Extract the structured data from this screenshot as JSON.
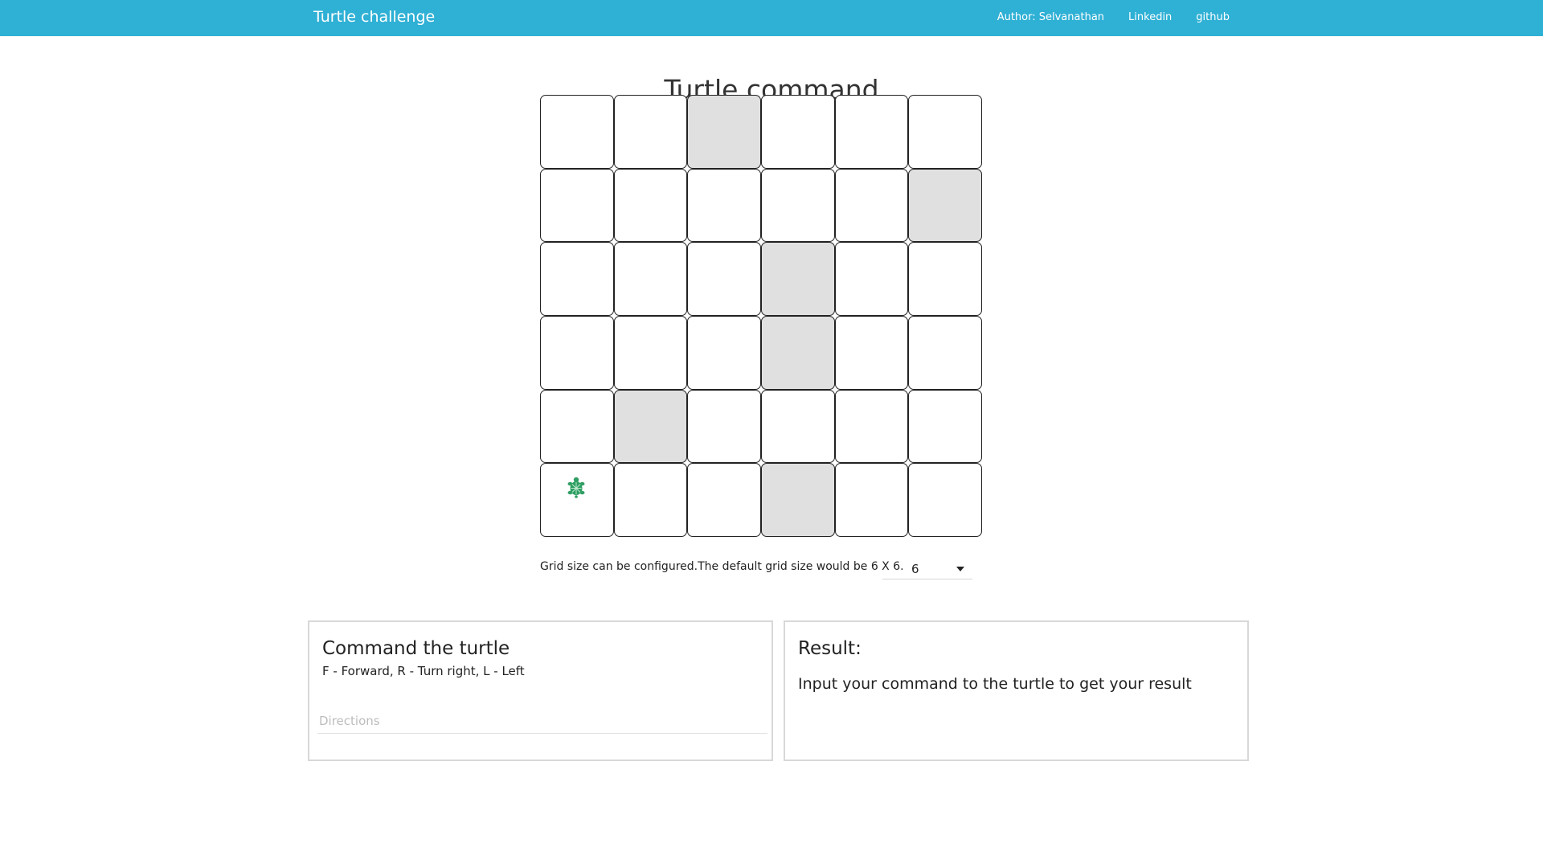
{
  "navbar": {
    "brand": "Turtle challenge",
    "links": [
      {
        "label": "Author: Selvanathan"
      },
      {
        "label": "Linkedin"
      },
      {
        "label": "github"
      }
    ]
  },
  "page_title": "Turtle command",
  "grid": {
    "size": 6,
    "rows": [
      [
        "empty",
        "empty",
        "blocked",
        "empty",
        "empty",
        "empty"
      ],
      [
        "empty",
        "empty",
        "empty",
        "empty",
        "empty",
        "blocked"
      ],
      [
        "empty",
        "empty",
        "empty",
        "blocked",
        "empty",
        "empty"
      ],
      [
        "empty",
        "empty",
        "empty",
        "blocked",
        "empty",
        "empty"
      ],
      [
        "empty",
        "blocked",
        "empty",
        "empty",
        "empty",
        "empty"
      ],
      [
        "turtle",
        "empty",
        "empty",
        "blocked",
        "empty",
        "empty"
      ]
    ],
    "turtle_icon": "turtle-icon",
    "colors": {
      "blocked": "#e0e0e0",
      "cell": "#ffffff",
      "turtle": "#2e9e62"
    }
  },
  "grid_config": {
    "note": "Grid size can be configured.The default grid size would be 6 X 6.",
    "selected_value": "6"
  },
  "command_panel": {
    "title": "Command the turtle",
    "legend": "F - Forward, R - Turn right, L - Left",
    "input_placeholder": "Directions",
    "input_value": ""
  },
  "result_panel": {
    "title": "Result:",
    "message": "Input your command to the turtle to get your result"
  },
  "colors": {
    "navbar": "#2fb0d5",
    "panel_border": "#d8d8d8"
  }
}
